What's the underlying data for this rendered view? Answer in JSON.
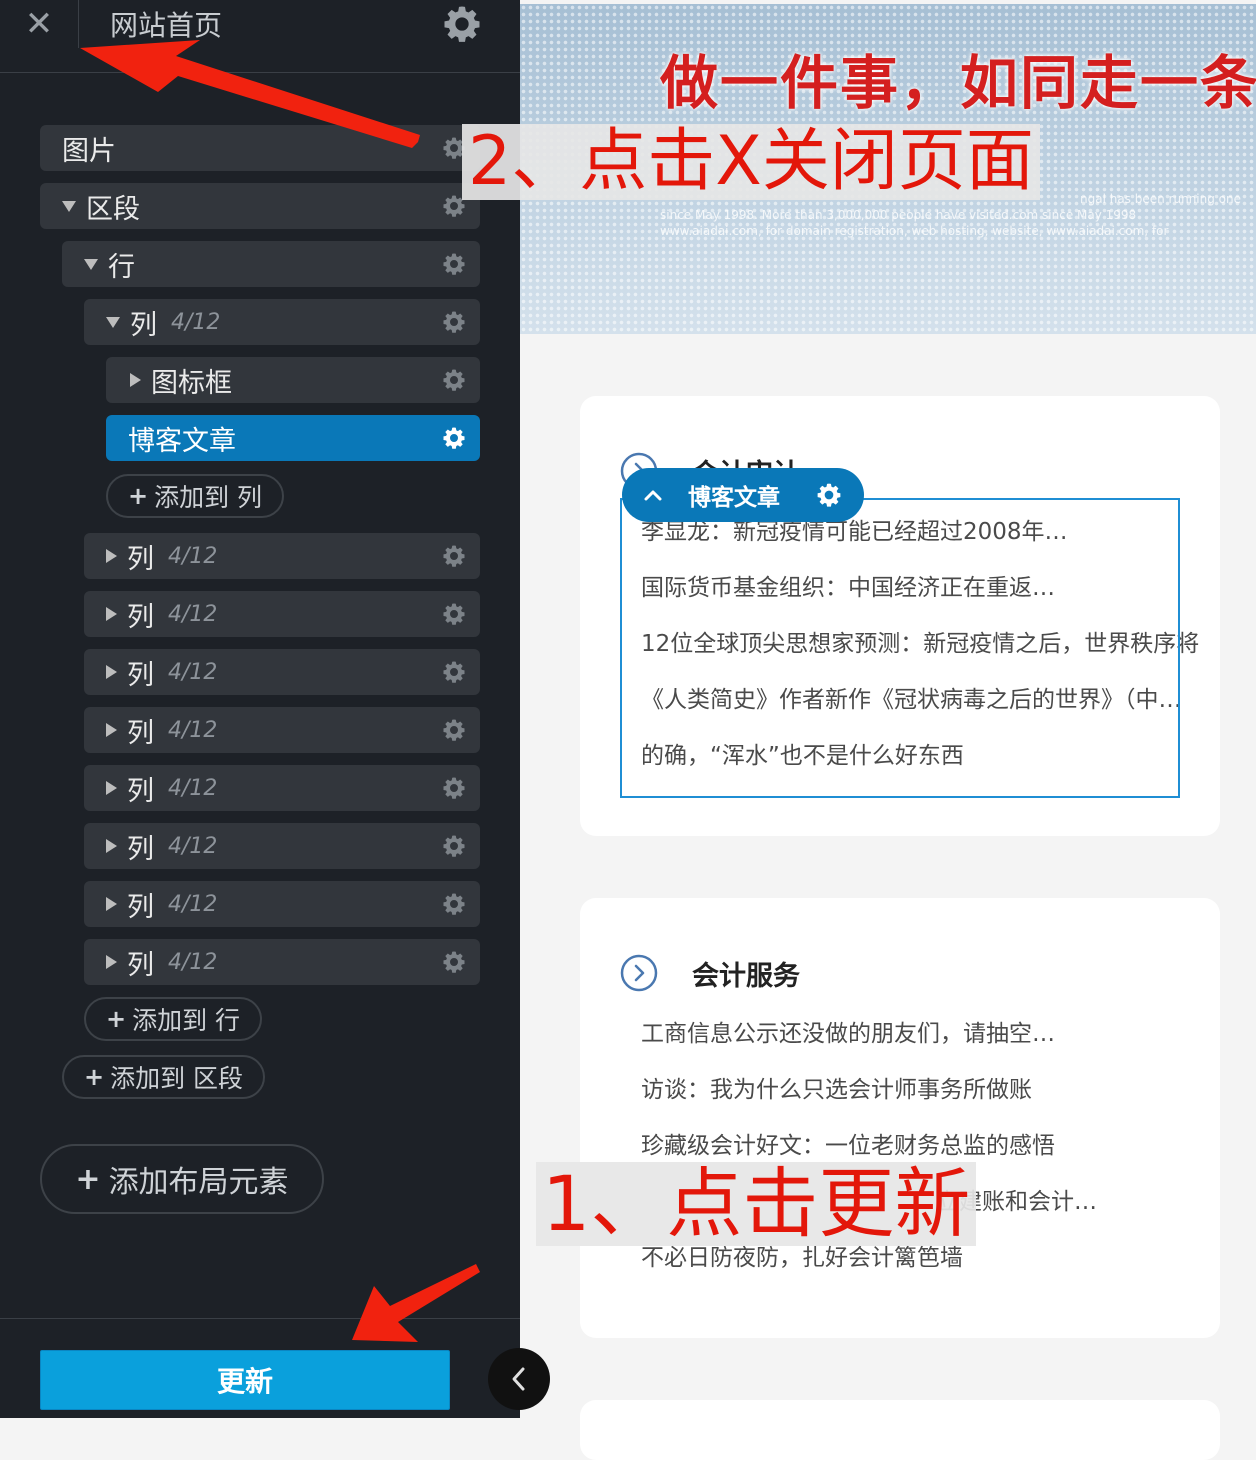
{
  "sidebar": {
    "title": "网站首页",
    "items": [
      {
        "label": "图片",
        "frac": ""
      },
      {
        "label": "区段",
        "frac": ""
      },
      {
        "label": "行",
        "frac": ""
      },
      {
        "label": "列",
        "frac": "4/12"
      },
      {
        "label": "图标框",
        "frac": ""
      },
      {
        "label": "博客文章",
        "frac": ""
      },
      {
        "label": "列",
        "frac": "4/12"
      },
      {
        "label": "列",
        "frac": "4/12"
      },
      {
        "label": "列",
        "frac": "4/12"
      },
      {
        "label": "列",
        "frac": "4/12"
      },
      {
        "label": "列",
        "frac": "4/12"
      },
      {
        "label": "列",
        "frac": "4/12"
      },
      {
        "label": "列",
        "frac": "4/12"
      },
      {
        "label": "列",
        "frac": "4/12"
      }
    ],
    "add_to_column": "添加到 列",
    "add_to_row": "添加到 行",
    "add_to_section": "添加到 区段",
    "add_layout_element": "添加布局元素",
    "update_button": "更新",
    "active_color": "#0a78b8"
  },
  "preview": {
    "banner_slogan": "做一件事，如同走一条路",
    "banner_text_1": "ngal has been running one",
    "banner_text_2": "since May 1998. More than 3,000,000 people have visited.com since May 1998",
    "banner_text_3": "www.aiadai.com, for domain registration, web hosting, website, www.aiadai.com, for",
    "card1": {
      "title": "会计审计",
      "posts": [
        "李显龙：新冠疫情可能已经超过2008年…",
        "国际货币基金组织：中国经济正在重返…",
        "12位全球顶尖思想家预测：新冠疫情之后，世界秩序将",
        "《人类简史》作者新作《冠状病毒之后的世界》（中…",
        "的确，“浑水”也不是什么好东西"
      ]
    },
    "element_pill_label": "博客文章",
    "card2": {
      "title": "会计服务",
      "posts": [
        "工商信息公示还没做的朋友们，请抽空…",
        "访谈：我为什么只选会计师事务所做账",
        "珍藏级会计好文：一位老财务总监的感悟",
        "立建账和会计…",
        "不必日防夜防，扎好会计篱笆墙"
      ]
    }
  },
  "annotations": {
    "step1": "1、点击更新",
    "step2": "2、点击X关闭页面",
    "color": "#e3170a"
  }
}
